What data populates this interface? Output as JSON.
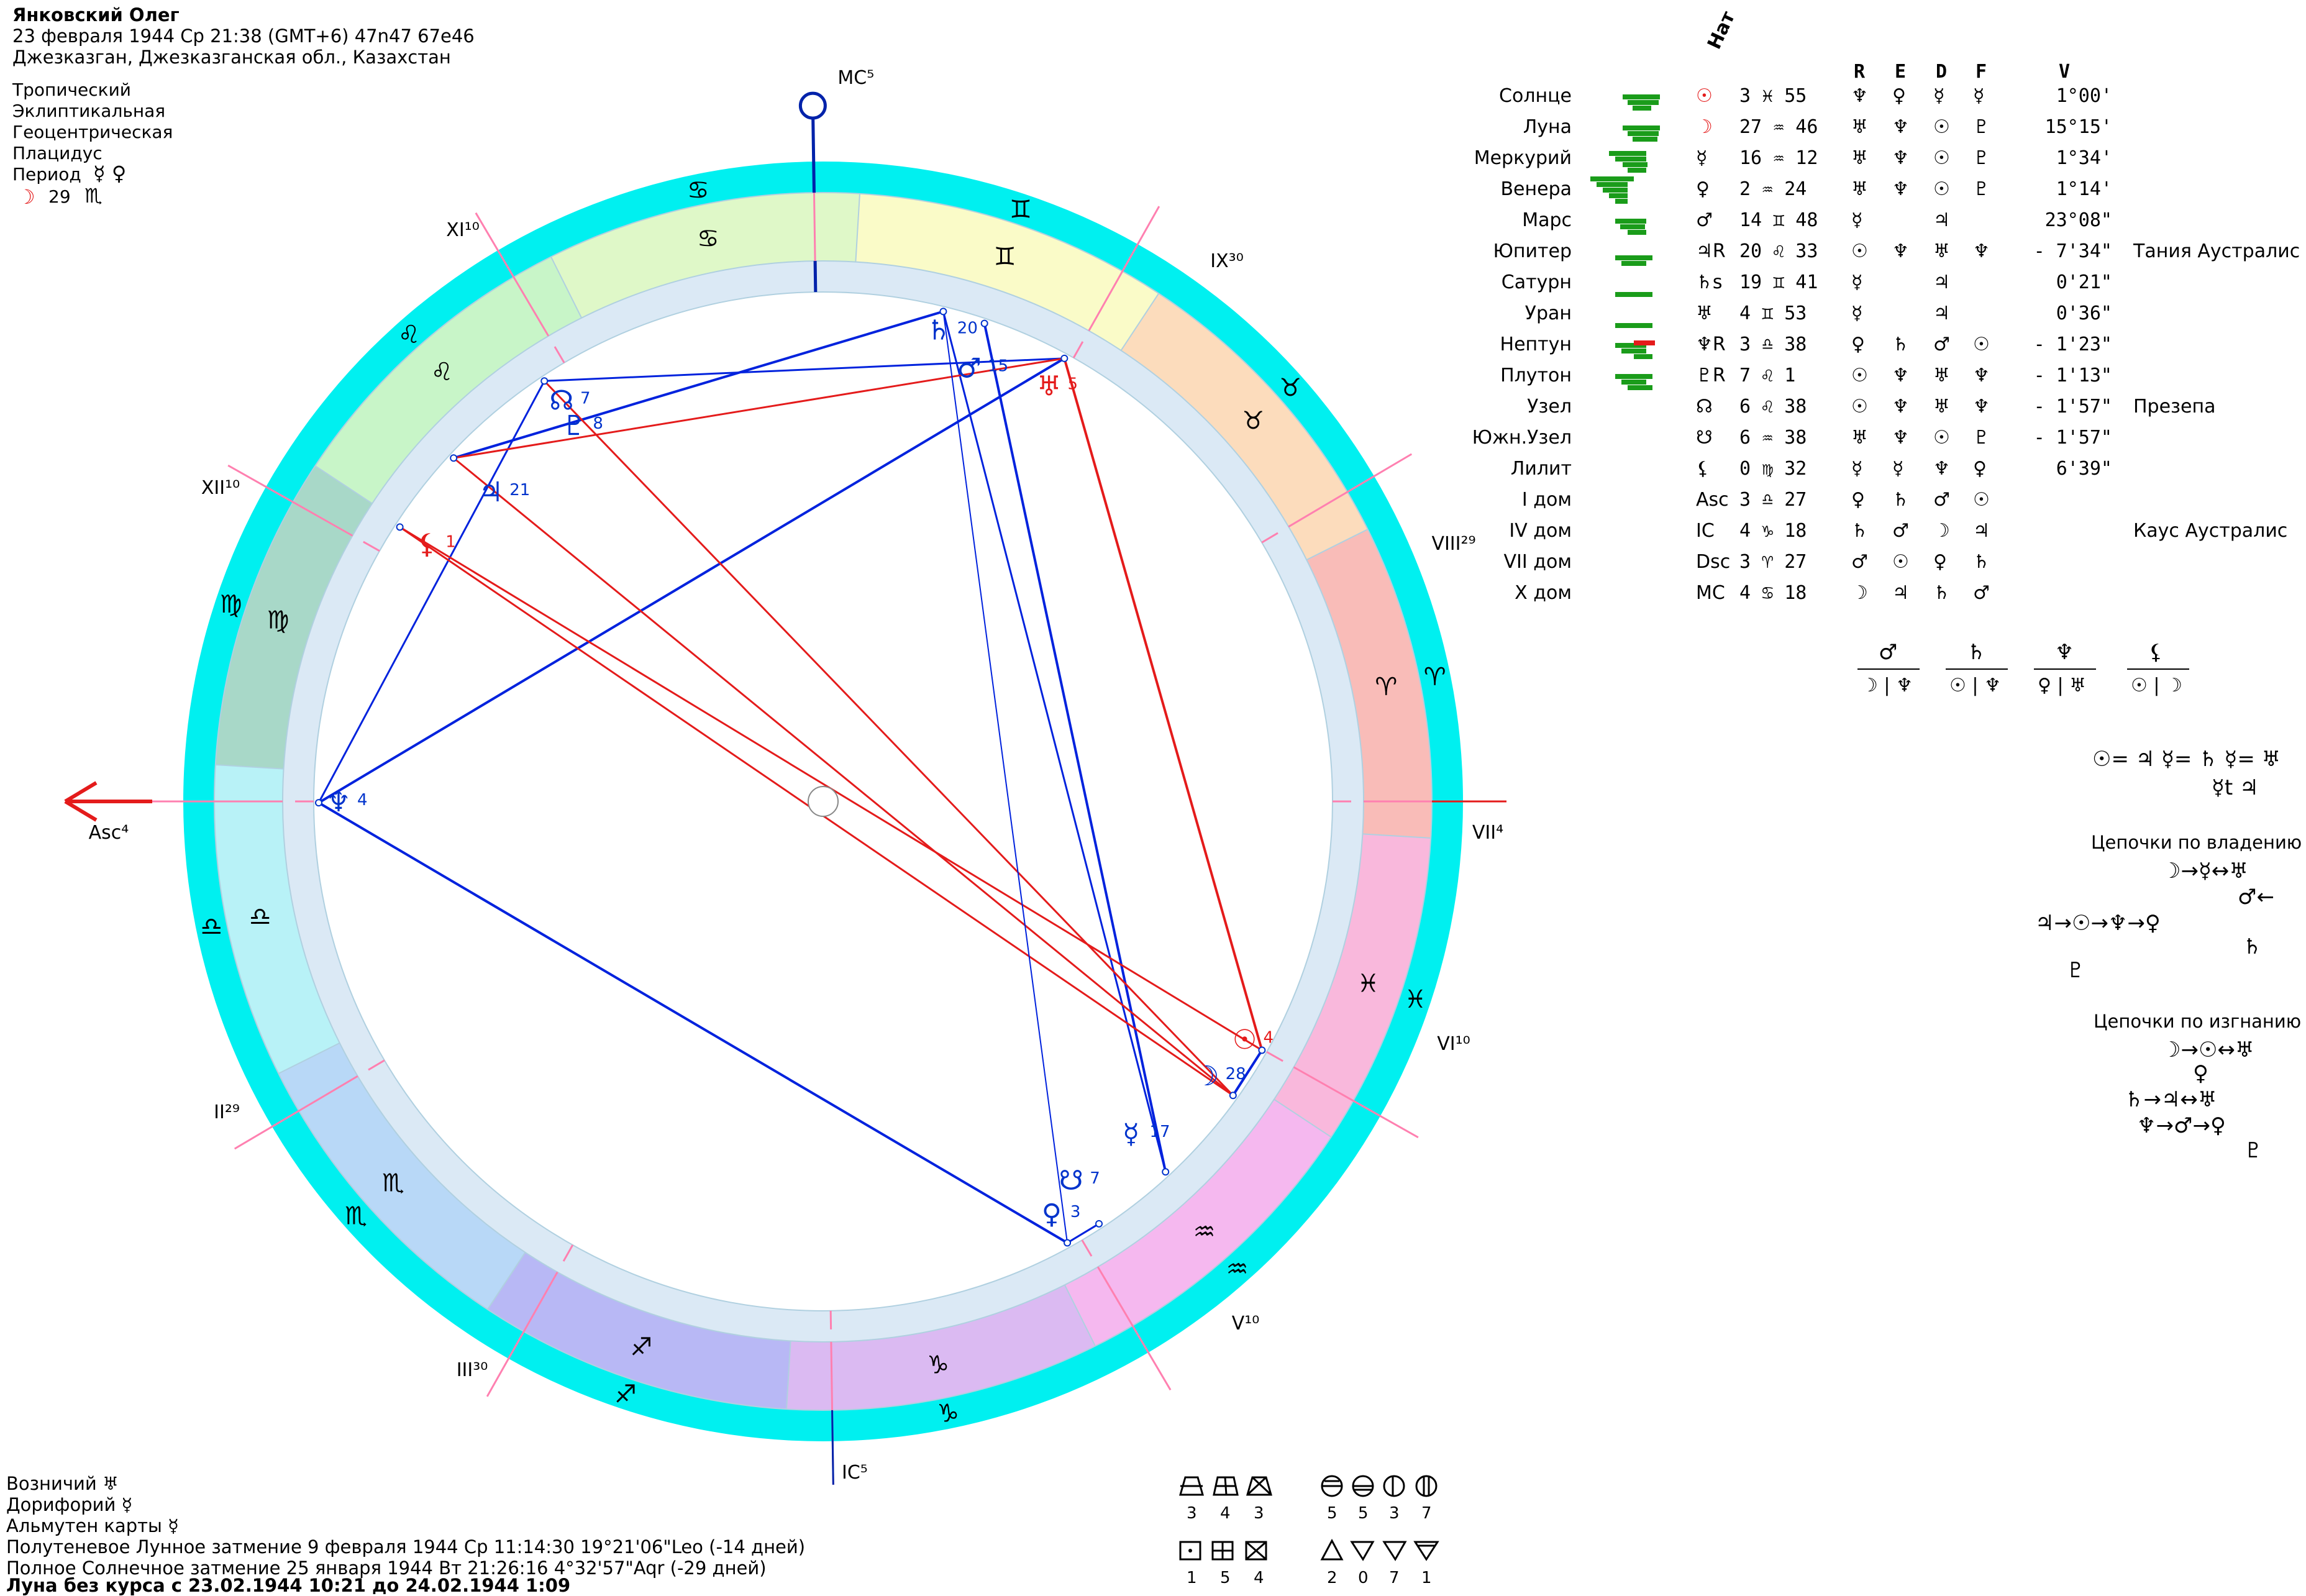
{
  "header": {
    "name": "Янковский Олег",
    "datetime": "23 февраля 1944  Ср  21:38 (GMT+6) 47n47  67e46",
    "place": "Джезказган, Джезказганская обл., Казахстан",
    "settings": [
      "Тропический",
      "Эклиптикальная",
      "Геоцентрическая",
      "Плацидус"
    ],
    "period_label": "Период",
    "period_symbols": "☿ ♀",
    "period_moon": "☽",
    "period_value": "29",
    "period_sign": "♏"
  },
  "table": {
    "nat_label": "Нат",
    "columns": [
      "R",
      "E",
      "D",
      "F",
      "V"
    ],
    "rows": [
      {
        "name": "Солнце",
        "glyph": "☉",
        "pos": "3 ♓ 55",
        "r": "♆",
        "e": "♀",
        "d": "☿",
        "f": "☿",
        "v": "1°00'",
        "star": ""
      },
      {
        "name": "Луна",
        "glyph": "☽",
        "pos": "27 ♒ 46",
        "r": "♅",
        "e": "♆",
        "d": "☉",
        "f": "♇",
        "v": "15°15'",
        "star": ""
      },
      {
        "name": "Меркурий",
        "glyph": "☿",
        "pos": "16 ♒ 12",
        "r": "♅",
        "e": "♆",
        "d": "☉",
        "f": "♇",
        "v": "1°34'",
        "star": ""
      },
      {
        "name": "Венера",
        "glyph": "♀",
        "pos": "2 ♒ 24",
        "r": "♅",
        "e": "♆",
        "d": "☉",
        "f": "♇",
        "v": "1°14'",
        "star": ""
      },
      {
        "name": "Марс",
        "glyph": "♂",
        "pos": "14 ♊ 48",
        "r": "☿",
        "e": "",
        "d": "♃",
        "f": "",
        "v": "23°08\"",
        "star": ""
      },
      {
        "name": "Юпитер",
        "glyph": "♃R",
        "pos": "20 ♌ 33",
        "r": "☉",
        "e": "♆",
        "d": "♅",
        "f": "♆",
        "v": "- 7'34\"",
        "star": "Тания Аустралис"
      },
      {
        "name": "Сатурн",
        "glyph": "♄s",
        "pos": "19 ♊ 41",
        "r": "☿",
        "e": "",
        "d": "♃",
        "f": "",
        "v": "0'21\"",
        "star": ""
      },
      {
        "name": "Уран",
        "glyph": "♅",
        "pos": "4 ♊ 53",
        "r": "☿",
        "e": "",
        "d": "♃",
        "f": "",
        "v": "0'36\"",
        "star": ""
      },
      {
        "name": "Нептун",
        "glyph": "♆R",
        "pos": "3 ♎ 38",
        "r": "♀",
        "e": "♄",
        "d": "♂",
        "f": "☉",
        "v": "- 1'23\"",
        "star": ""
      },
      {
        "name": "Плутон",
        "glyph": "♇R",
        "pos": "7 ♌ 1",
        "r": "☉",
        "e": "♆",
        "d": "♅",
        "f": "♆",
        "v": "- 1'13\"",
        "star": ""
      },
      {
        "name": "Узел",
        "glyph": "☊",
        "pos": "6 ♌ 38",
        "r": "☉",
        "e": "♆",
        "d": "♅",
        "f": "♆",
        "v": "- 1'57\"",
        "star": "Презепа"
      },
      {
        "name": "Южн.Узел",
        "glyph": "☋",
        "pos": "6 ♒ 38",
        "r": "♅",
        "e": "♆",
        "d": "☉",
        "f": "♇",
        "v": "- 1'57\"",
        "star": ""
      },
      {
        "name": "Лилит",
        "glyph": "⚸",
        "pos": "0 ♍ 32",
        "r": "☿",
        "e": "☿",
        "d": "♆",
        "f": "♀",
        "v": "6'39\"",
        "star": ""
      },
      {
        "name": "I дом",
        "glyph": "Asc",
        "pos": "3 ♎ 27",
        "r": "♀",
        "e": "♄",
        "d": "♂",
        "f": "☉",
        "v": "",
        "star": ""
      },
      {
        "name": "IV дом",
        "glyph": "IC",
        "pos": "4 ♑ 18",
        "r": "♄",
        "e": "♂",
        "d": "☽",
        "f": "♃",
        "v": "",
        "star": "Каус Аустралис"
      },
      {
        "name": "VII дом",
        "glyph": "Dsc",
        "pos": "3 ♈ 27",
        "r": "♂",
        "e": "☉",
        "d": "♀",
        "f": "♄",
        "v": "",
        "star": ""
      },
      {
        "name": "X дом",
        "glyph": "MC",
        "pos": "4 ♋ 18",
        "r": "☽",
        "e": "♃",
        "d": "♄",
        "f": "♂",
        "v": "",
        "star": ""
      }
    ]
  },
  "dispositors": [
    {
      "top": "♂",
      "bottom": "☽ | ♆"
    },
    {
      "top": "♄",
      "bottom": "☉ | ♆"
    },
    {
      "top": "♆",
      "bottom": "♀ | ♅"
    },
    {
      "top": "⚸",
      "bottom": "☉ | ☽"
    }
  ],
  "chains": {
    "equal_line1": "☉= ♃ ☿= ♄ ☿= ♅",
    "equal_line2": "☿t ♃",
    "ownership_title": "Цепочки по владению",
    "ownership": [
      "☽→☿↔♅",
      "♂←",
      "♃→☉→♆→♀",
      "♄",
      "♇"
    ],
    "exile_title": "Цепочки по изгнанию",
    "exile": [
      "☽→☉↔♅",
      "♀",
      "♄→♃↔♅",
      "♆→♂→♀",
      "♇"
    ]
  },
  "chart": {
    "mc_label": "MC⁵",
    "ic_label": "IC⁵",
    "asc_label": "Asc⁴",
    "houses": [
      {
        "label": "XI¹⁰"
      },
      {
        "label": "IX³⁰"
      },
      {
        "label": "XII¹⁰"
      },
      {
        "label": "VIII²⁹"
      },
      {
        "label": "VII⁴"
      },
      {
        "label": "VI¹⁰"
      },
      {
        "label": "II²⁹"
      },
      {
        "label": "V¹⁰"
      },
      {
        "label": "III³⁰"
      }
    ],
    "signs": [
      "♋",
      "♊",
      "♉",
      "♈",
      "♓",
      "♒",
      "♑",
      "♐",
      "♏",
      "♎",
      "♍",
      "♌"
    ],
    "planets": [
      {
        "glyph": "♄",
        "deg": "20"
      },
      {
        "glyph": "♂",
        "deg": "15"
      },
      {
        "glyph": "♅",
        "deg": "5"
      },
      {
        "glyph": "☊",
        "deg": "7"
      },
      {
        "glyph": "♇",
        "deg": "8"
      },
      {
        "glyph": "♃",
        "deg": "21"
      },
      {
        "glyph": "⚸",
        "deg": "1"
      },
      {
        "glyph": "♆",
        "deg": "4"
      },
      {
        "glyph": "☉",
        "deg": "4"
      },
      {
        "glyph": "☽",
        "deg": "28"
      },
      {
        "glyph": "☿",
        "deg": "17"
      },
      {
        "glyph": "♀",
        "deg": "3"
      },
      {
        "glyph": "☋",
        "deg": "7"
      }
    ],
    "colors": {
      "outer_ring": "#00f0f0",
      "aspect_harmonic": "#0022dd",
      "aspect_tense": "#e41b1b"
    }
  },
  "footer": {
    "lines": [
      "Возничий ♅",
      "Дорифорий ☿",
      "Альмутен карты ☿",
      "Полутеневое Лунное затмение 9 февраля 1944 Ср 11:14:30 19°21'06\"Leo (-14 дней)",
      "Полное Солнечное затмение 25 января 1944 Вт 21:26:16  4°32'57\"Aqr (-29 дней)"
    ],
    "bold_line": "Луна без курса с 23.02.1944 10:21 до 24.02.1944  1:09"
  },
  "figures": {
    "row1": [
      {
        "icon": "trapezoid-icon",
        "count": "3"
      },
      {
        "icon": "grid-icon",
        "count": "4"
      },
      {
        "icon": "kite-icon",
        "count": "3"
      },
      {
        "icon": "circle-h-icon",
        "count": "5"
      },
      {
        "icon": "circle-half-icon",
        "count": "5"
      },
      {
        "icon": "circle-moon-icon",
        "count": "3"
      },
      {
        "icon": "circle-v-icon",
        "count": "7"
      }
    ],
    "row2": [
      {
        "icon": "square-dot-icon",
        "count": "1"
      },
      {
        "icon": "square-cross-icon",
        "count": "5"
      },
      {
        "icon": "square-x-icon",
        "count": "4"
      },
      {
        "icon": "triangle-up-icon",
        "count": "2"
      },
      {
        "icon": "triangle-down-icon",
        "count": "0"
      },
      {
        "icon": "triangle-dot-icon",
        "count": "7"
      },
      {
        "icon": "triangle-bar-icon",
        "count": "1"
      }
    ]
  }
}
